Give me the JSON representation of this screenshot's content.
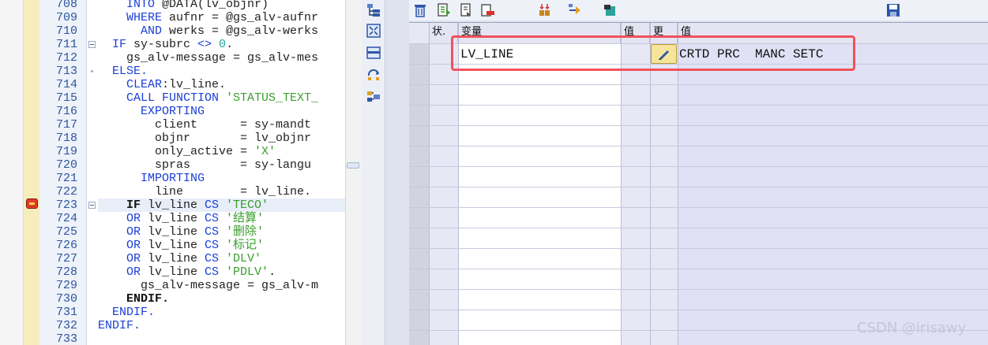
{
  "editor": {
    "lines": [
      {
        "no": "708",
        "fold": "",
        "tokens": [
          {
            "t": "    INTO ",
            "c": "k"
          },
          {
            "t": "@DATA(",
            "c": "p"
          },
          {
            "t": "lv_objnr",
            "c": "v"
          },
          {
            "t": ")",
            "c": "p"
          }
        ]
      },
      {
        "no": "709",
        "fold": "",
        "tokens": [
          {
            "t": "    WHERE ",
            "c": "k"
          },
          {
            "t": "aufnr = ",
            "c": "v"
          },
          {
            "t": "@gs_alv-aufnr",
            "c": "v"
          }
        ]
      },
      {
        "no": "710",
        "fold": "",
        "tokens": [
          {
            "t": "      AND ",
            "c": "k"
          },
          {
            "t": "werks = ",
            "c": "v"
          },
          {
            "t": "@gs_alv-werks",
            "c": "v"
          }
        ]
      },
      {
        "no": "711",
        "fold": "box",
        "tokens": [
          {
            "t": "  IF ",
            "c": "k"
          },
          {
            "t": "sy-subrc ",
            "c": "v"
          },
          {
            "t": "<> ",
            "c": "k"
          },
          {
            "t": "0",
            "c": "n"
          },
          {
            "t": ".",
            "c": "p"
          }
        ]
      },
      {
        "no": "712",
        "fold": "",
        "tokens": [
          {
            "t": "    gs_alv-message = gs_alv-mes",
            "c": "v"
          }
        ]
      },
      {
        "no": "713",
        "fold": "dot",
        "tokens": [
          {
            "t": "  ELSE.",
            "c": "k"
          }
        ]
      },
      {
        "no": "714",
        "fold": "",
        "tokens": [
          {
            "t": "    CLEAR",
            "c": "k"
          },
          {
            "t": ":lv_line.",
            "c": "v"
          }
        ]
      },
      {
        "no": "715",
        "fold": "",
        "tokens": [
          {
            "t": "    CALL FUNCTION ",
            "c": "k"
          },
          {
            "t": "'STATUS_TEXT_",
            "c": "s"
          }
        ]
      },
      {
        "no": "716",
        "fold": "",
        "tokens": [
          {
            "t": "      EXPORTING",
            "c": "k"
          }
        ]
      },
      {
        "no": "717",
        "fold": "",
        "tokens": [
          {
            "t": "        client      = sy-mandt",
            "c": "v"
          }
        ]
      },
      {
        "no": "718",
        "fold": "",
        "tokens": [
          {
            "t": "        objnr       = lv_objnr",
            "c": "v"
          }
        ]
      },
      {
        "no": "719",
        "fold": "",
        "tokens": [
          {
            "t": "        only_active = ",
            "c": "v"
          },
          {
            "t": "'X'",
            "c": "s"
          }
        ]
      },
      {
        "no": "720",
        "fold": "",
        "tokens": [
          {
            "t": "        spras       = sy-langu",
            "c": "v"
          }
        ]
      },
      {
        "no": "721",
        "fold": "",
        "tokens": [
          {
            "t": "      IMPORTING",
            "c": "k"
          }
        ]
      },
      {
        "no": "722",
        "fold": "",
        "tokens": [
          {
            "t": "        line        = lv_line.",
            "c": "v"
          }
        ]
      },
      {
        "no": "723",
        "fold": "box",
        "current": true,
        "tokens": [
          {
            "t": "    IF ",
            "c": "b"
          },
          {
            "t": "lv_line ",
            "c": "v"
          },
          {
            "t": "CS ",
            "c": "k"
          },
          {
            "t": "'TECO'",
            "c": "s"
          }
        ]
      },
      {
        "no": "724",
        "fold": "",
        "tokens": [
          {
            "t": "    OR ",
            "c": "k"
          },
          {
            "t": "lv_line ",
            "c": "v"
          },
          {
            "t": "CS ",
            "c": "k"
          },
          {
            "t": "'结算'",
            "c": "s"
          }
        ]
      },
      {
        "no": "725",
        "fold": "",
        "tokens": [
          {
            "t": "    OR ",
            "c": "k"
          },
          {
            "t": "lv_line ",
            "c": "v"
          },
          {
            "t": "CS ",
            "c": "k"
          },
          {
            "t": "'删除'",
            "c": "s"
          }
        ]
      },
      {
        "no": "726",
        "fold": "",
        "tokens": [
          {
            "t": "    OR ",
            "c": "k"
          },
          {
            "t": "lv_line ",
            "c": "v"
          },
          {
            "t": "CS ",
            "c": "k"
          },
          {
            "t": "'标记'",
            "c": "s"
          }
        ]
      },
      {
        "no": "727",
        "fold": "",
        "tokens": [
          {
            "t": "    OR ",
            "c": "k"
          },
          {
            "t": "lv_line ",
            "c": "v"
          },
          {
            "t": "CS ",
            "c": "k"
          },
          {
            "t": "'DLV'",
            "c": "s"
          }
        ]
      },
      {
        "no": "728",
        "fold": "",
        "tokens": [
          {
            "t": "    OR ",
            "c": "k"
          },
          {
            "t": "lv_line ",
            "c": "v"
          },
          {
            "t": "CS ",
            "c": "k"
          },
          {
            "t": "'PDLV'",
            "c": "s"
          },
          {
            "t": ".",
            "c": "p"
          }
        ]
      },
      {
        "no": "729",
        "fold": "",
        "tokens": [
          {
            "t": "      gs_alv-message = gs_alv-m",
            "c": "v"
          }
        ]
      },
      {
        "no": "730",
        "fold": "",
        "tokens": [
          {
            "t": "    ENDIF.",
            "c": "b"
          }
        ]
      },
      {
        "no": "731",
        "fold": "",
        "tokens": [
          {
            "t": "  ENDIF.",
            "c": "k"
          }
        ]
      },
      {
        "no": "732",
        "fold": "",
        "tokens": [
          {
            "t": "ENDIF.",
            "c": "k"
          }
        ]
      },
      {
        "no": "733",
        "fold": "",
        "tokens": []
      }
    ]
  },
  "vtoolbar": {
    "icons": [
      "tree-expand-icon",
      "fit-screen-icon",
      "layout-icon",
      "refresh-icon",
      "structure-icon"
    ]
  },
  "htoolbar": {
    "icons": [
      "delete-icon",
      "export-icon",
      "delete-row-icon",
      "change-layout-icon",
      "navigate-icon",
      "print-icon",
      "save-icon"
    ]
  },
  "variables": {
    "columns": [
      "状.",
      "变量",
      "值",
      "更",
      "值"
    ],
    "rows": [
      {
        "name": "LV_LINE",
        "value": "CRTD PRC  MANC SETC"
      }
    ]
  },
  "watermark": "CSDN @irisawy",
  "colors": {
    "highlight_box": "#f0525a",
    "keyword": "#1b3fd6",
    "string": "#3a9e2c",
    "number": "#23a39c"
  }
}
